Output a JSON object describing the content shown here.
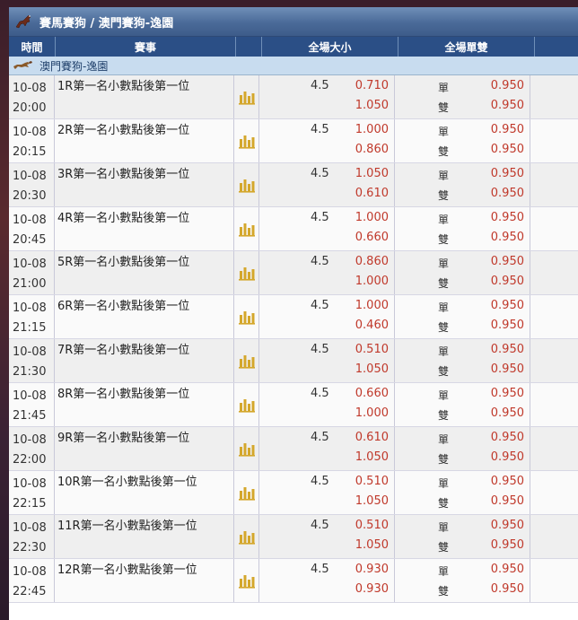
{
  "title": "賽馬賽狗 / 澳門賽狗-逸園",
  "columns": {
    "time": "時間",
    "event": "賽事",
    "over_under": "全場大小",
    "odd_even": "全場單雙"
  },
  "league_name": "澳門賽狗-逸園",
  "labels": {
    "odd": "單",
    "even": "雙"
  },
  "colors": {
    "header": "#2b4f86",
    "odds": "#c0392b",
    "league_bar": "#c8dcef",
    "chart_icon": "#d4a72c"
  },
  "rows": [
    {
      "date": "10-08",
      "time": "20:00",
      "event": "1R第一名小數點後第一位",
      "line": "4.5",
      "over": "0.710",
      "under": "1.050",
      "odd": "0.950",
      "even": "0.950"
    },
    {
      "date": "10-08",
      "time": "20:15",
      "event": "2R第一名小數點後第一位",
      "line": "4.5",
      "over": "1.000",
      "under": "0.860",
      "odd": "0.950",
      "even": "0.950"
    },
    {
      "date": "10-08",
      "time": "20:30",
      "event": "3R第一名小數點後第一位",
      "line": "4.5",
      "over": "1.050",
      "under": "0.610",
      "odd": "0.950",
      "even": "0.950"
    },
    {
      "date": "10-08",
      "time": "20:45",
      "event": "4R第一名小數點後第一位",
      "line": "4.5",
      "over": "1.000",
      "under": "0.660",
      "odd": "0.950",
      "even": "0.950"
    },
    {
      "date": "10-08",
      "time": "21:00",
      "event": "5R第一名小數點後第一位",
      "line": "4.5",
      "over": "0.860",
      "under": "1.000",
      "odd": "0.950",
      "even": "0.950"
    },
    {
      "date": "10-08",
      "time": "21:15",
      "event": "6R第一名小數點後第一位",
      "line": "4.5",
      "over": "1.000",
      "under": "0.460",
      "odd": "0.950",
      "even": "0.950"
    },
    {
      "date": "10-08",
      "time": "21:30",
      "event": "7R第一名小數點後第一位",
      "line": "4.5",
      "over": "0.510",
      "under": "1.050",
      "odd": "0.950",
      "even": "0.950"
    },
    {
      "date": "10-08",
      "time": "21:45",
      "event": "8R第一名小數點後第一位",
      "line": "4.5",
      "over": "0.660",
      "under": "1.000",
      "odd": "0.950",
      "even": "0.950"
    },
    {
      "date": "10-08",
      "time": "22:00",
      "event": "9R第一名小數點後第一位",
      "line": "4.5",
      "over": "0.610",
      "under": "1.050",
      "odd": "0.950",
      "even": "0.950"
    },
    {
      "date": "10-08",
      "time": "22:15",
      "event": "10R第一名小數點後第一位",
      "line": "4.5",
      "over": "0.510",
      "under": "1.050",
      "odd": "0.950",
      "even": "0.950"
    },
    {
      "date": "10-08",
      "time": "22:30",
      "event": "11R第一名小數點後第一位",
      "line": "4.5",
      "over": "0.510",
      "under": "1.050",
      "odd": "0.950",
      "even": "0.950"
    },
    {
      "date": "10-08",
      "time": "22:45",
      "event": "12R第一名小數點後第一位",
      "line": "4.5",
      "over": "0.930",
      "under": "0.930",
      "odd": "0.950",
      "even": "0.950"
    }
  ]
}
